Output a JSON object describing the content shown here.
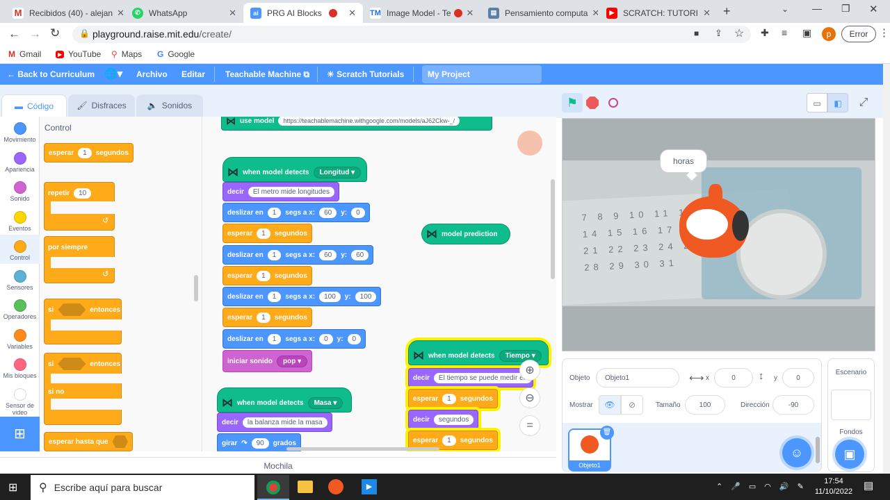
{
  "browser": {
    "tabs": [
      {
        "label": "Recibidos (40) - alejan",
        "icon": "gmail-icon"
      },
      {
        "label": "WhatsApp",
        "icon": "whatsapp-icon"
      },
      {
        "label": "PRG AI Blocks",
        "icon": "ai-icon"
      },
      {
        "label": "Image Model - Te",
        "icon": "tm-icon"
      },
      {
        "label": "Pensamiento computa",
        "icon": "doc-icon"
      },
      {
        "label": "SCRATCH: TUTORI",
        "icon": "youtube-icon"
      }
    ],
    "url_host": "playground.raise.mit.edu",
    "url_path": "/create/",
    "profile_initial": "p",
    "error_label": "Error",
    "bookmarks": [
      "Gmail",
      "YouTube",
      "Maps",
      "Google"
    ]
  },
  "menu": {
    "back": "← Back to Curriculum",
    "file": "Archivo",
    "edit": "Editar",
    "teachable": "Teachable Machine",
    "tutorials": "Scratch Tutorials",
    "project_title": "My Project"
  },
  "editor_tabs": {
    "code": "Código",
    "costumes": "Disfraces",
    "sounds": "Sonidos"
  },
  "categories": [
    {
      "label": "Movimiento",
      "color": "#4c97ff"
    },
    {
      "label": "Apariencia",
      "color": "#9966ff"
    },
    {
      "label": "Sonido",
      "color": "#cf63cf"
    },
    {
      "label": "Eventos",
      "color": "#ffd500"
    },
    {
      "label": "Control",
      "color": "#ffab19"
    },
    {
      "label": "Sensores",
      "color": "#5cb1d6"
    },
    {
      "label": "Operadores",
      "color": "#59c059"
    },
    {
      "label": "Variables",
      "color": "#ff8c1a"
    },
    {
      "label": "Mis bloques",
      "color": "#ff6680"
    },
    {
      "label": "Sensor de video",
      "color": "#ffffff"
    }
  ],
  "palette": {
    "heading": "Control",
    "wait": "esperar",
    "wait_val": "1",
    "seconds": "segundos",
    "repeat": "repetir",
    "repeat_val": "10",
    "forever": "por siempre",
    "if": "si",
    "then": "entonces",
    "if2": "si",
    "then2": "entonces",
    "else": "si no",
    "wait_until": "esperar hasta que"
  },
  "scripts": {
    "use_model": "use model",
    "model_url": "https://teachablemachine.withgoogle.com/models/aJ62Ckw-_/",
    "s1": {
      "hat": "when model detects",
      "hat_opt": "Longitud",
      "say": "decir",
      "say_val": "El metro mide longitudes",
      "glide": "deslizar en",
      "secs_to_x": "segs a x:",
      "y": "y:",
      "g1": [
        "1",
        "60",
        "0"
      ],
      "g2": [
        "1",
        "60",
        "60"
      ],
      "g3": [
        "1",
        "100",
        "100"
      ],
      "g4": [
        "1",
        "0",
        "0"
      ],
      "wait": "esperar",
      "wait_val": "1",
      "seconds": "segundos",
      "play": "iniciar sonido",
      "play_val": "pop"
    },
    "s2": {
      "hat": "when model detects",
      "hat_opt": "Masa",
      "say": "decir",
      "say_val": "la balanza mide la masa",
      "turn": "girar",
      "turn_val": "90",
      "degrees": "grados"
    },
    "s3": {
      "hat": "when model detects",
      "hat_opt": "Tiempo",
      "say": "decir",
      "say_val": "El tiempo se puede medir en",
      "wait": "esperar",
      "wait_val": "1",
      "seconds": "segundos",
      "say2_val": "segundos"
    },
    "prediction": "model prediction"
  },
  "backpack": "Mochila",
  "stage": {
    "speech": "horas",
    "calendar_rows": [
      "7 8 9 10 11 12 13",
      "14 15 16 17 18 19 20",
      "21 22 23 24 25 26 27",
      "28 29 30 31"
    ]
  },
  "sprite_info": {
    "sprite_label": "Objeto",
    "sprite_name": "Objeto1",
    "x_label": "x",
    "x_val": "0",
    "y_label": "y",
    "y_val": "0",
    "show_label": "Mostrar",
    "size_label": "Tamaño",
    "size_val": "100",
    "dir_label": "Dirección",
    "dir_val": "-90",
    "thumb_label": "Objeto1"
  },
  "stage_pane": {
    "title": "Escenario",
    "backdrops": "Fondos"
  },
  "taskbar": {
    "search_placeholder": "Escribe aquí para buscar",
    "time": "17:54",
    "date": "11/10/2022"
  },
  "colors": {
    "scratch_blue": "#4c97ff",
    "control": "#ffab19",
    "ml_green": "#0fbd8c"
  }
}
